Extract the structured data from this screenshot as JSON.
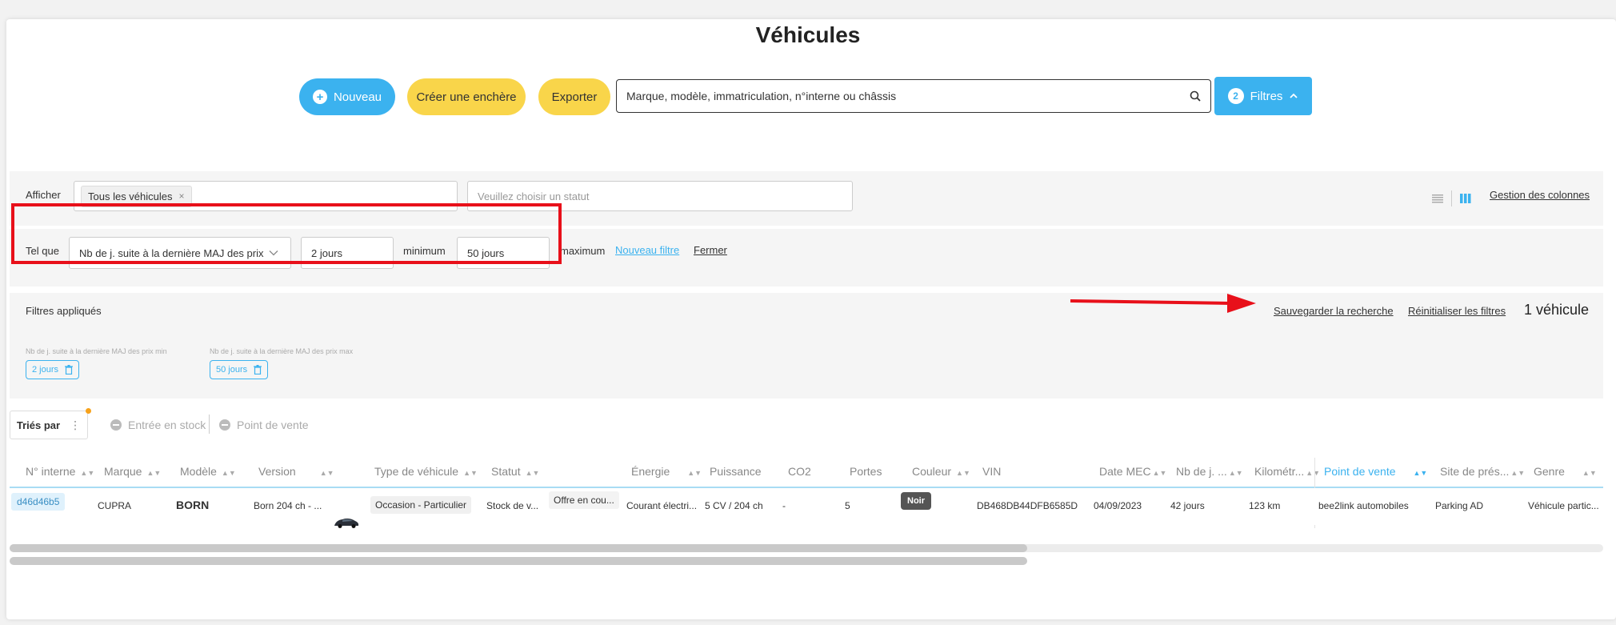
{
  "page": {
    "title": "Véhicules"
  },
  "toolbar": {
    "new_label": "Nouveau",
    "auction_label": "Créer une enchère",
    "export_label": "Exporter",
    "search_placeholder": "Marque, modèle, immatriculation, n°interne ou châssis",
    "filters_count": "2",
    "filters_label": "Filtres"
  },
  "display": {
    "label": "Afficher",
    "chip": "Tous les véhicules",
    "status_placeholder": "Veuillez choisir un statut",
    "columns_link": "Gestion des colonnes"
  },
  "filter_row": {
    "label": "Tel que",
    "field": "Nb de j. suite à la dernière MAJ des prix",
    "min_value": "2 jours",
    "min_label": "minimum",
    "max_value": "50 jours",
    "max_label": "maximum",
    "new_filter": "Nouveau filtre",
    "close": "Fermer"
  },
  "applied": {
    "label": "Filtres appliqués",
    "save_search": "Sauvegarder la recherche",
    "reset": "Réinitialiser les filtres",
    "count": "1 véhicule",
    "tags": [
      {
        "caption": "Nb de j. suite à la dernière MAJ des prix min",
        "value": "2 jours"
      },
      {
        "caption": "Nb de j. suite à la dernière MAJ des prix max",
        "value": "50 jours"
      }
    ]
  },
  "sort": {
    "label": "Triés par",
    "options": [
      "Entrée en stock",
      "Point de vente"
    ]
  },
  "table": {
    "headers": [
      "N° interne",
      "Marque",
      "Modèle",
      "Version",
      "Type de véhicule",
      "Statut",
      "Énergie",
      "Puissance",
      "CO2",
      "Portes",
      "Couleur",
      "VIN",
      "Date MEC",
      "Nb de j. ...",
      "Kilométr...",
      "Point de vente",
      "Site de prés...",
      "Genre"
    ],
    "row": {
      "id": "d46d46b5",
      "marque": "CUPRA",
      "modele": "BORN",
      "version": "Born 204 ch - ...",
      "type": "Occasion - Particulier",
      "statut": "Stock de v...",
      "offre": "Offre en cou...",
      "energie": "Courant électri...",
      "puissance": "5 CV / 204 ch",
      "co2": "-",
      "portes": "5",
      "couleur": "Noir",
      "vin": "DB468DB44DFB6585D",
      "date_mec": "04/09/2023",
      "nb_jours": "42 jours",
      "km": "123 km",
      "point_vente": "bee2link automobiles",
      "site": "Parking AD",
      "genre": "Véhicule partic..."
    }
  },
  "colors": {
    "accent": "#3bb2ef",
    "yellow": "#f9d54a",
    "highlight": "#e8101a"
  }
}
